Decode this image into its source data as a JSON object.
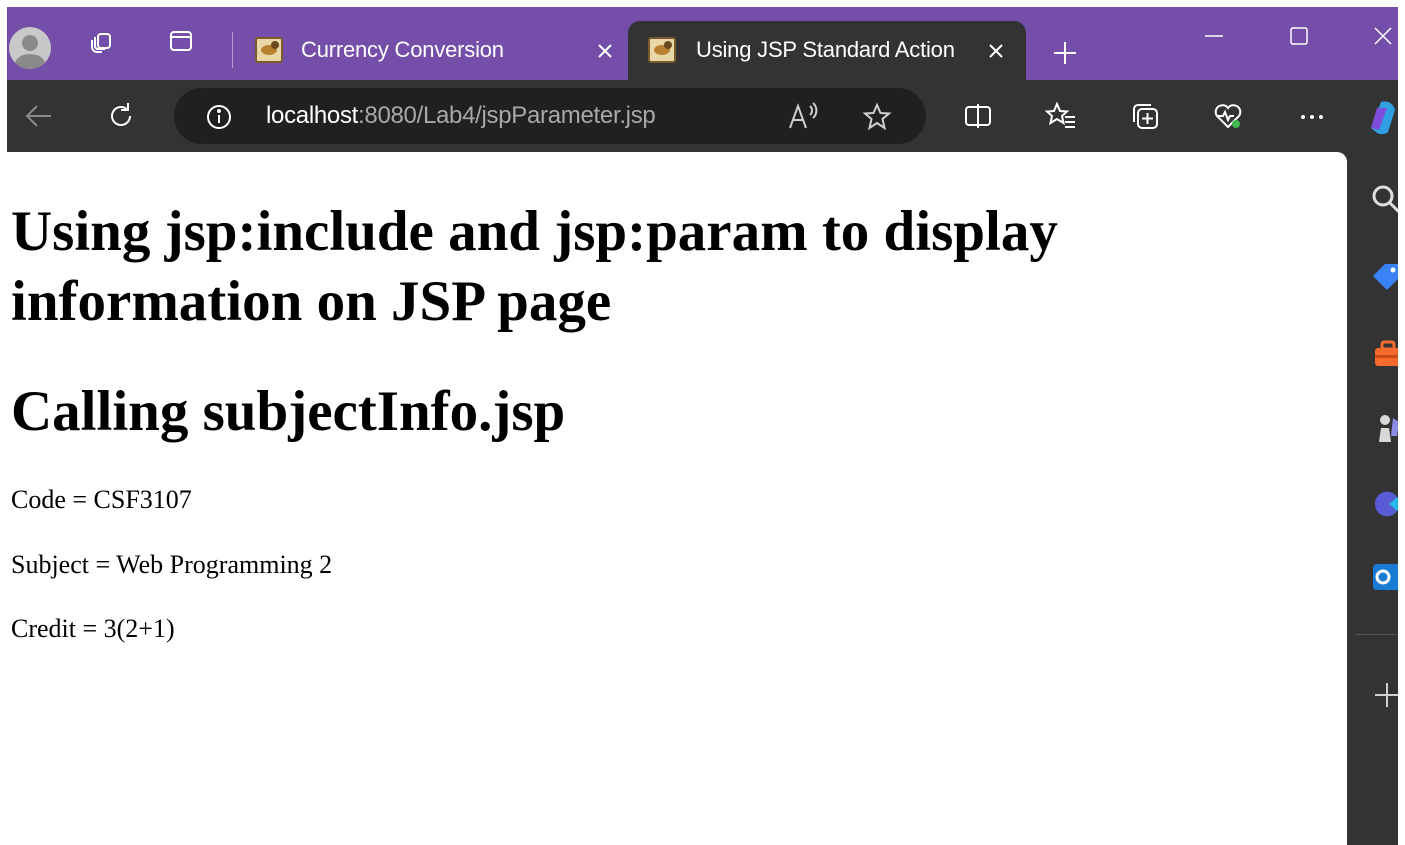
{
  "tabs": [
    {
      "title": "Currency Conversion",
      "active": false,
      "favicon": "tomcat-icon"
    },
    {
      "title": "Using JSP Standard Action",
      "active": true,
      "favicon": "tomcat-icon"
    }
  ],
  "address_bar": {
    "host": "localhost",
    "rest": ":8080/Lab4/jspParameter.jsp"
  },
  "page": {
    "heading": "Using jsp:include and jsp:param to display information on JSP page",
    "subheading": "Calling subjectInfo.jsp",
    "lines": [
      "Code = CSF3107",
      "Subject = Web Programming 2",
      "Credit = 3(2+1)"
    ]
  },
  "colors": {
    "tabstrip": "#744ea8",
    "toolbar": "#333333",
    "address_field": "#202020",
    "page_background": "#ffffff"
  },
  "icons": {
    "sidebar": [
      "search-icon",
      "tag-icon",
      "toolbox-icon",
      "chess-icon",
      "copilot-icon",
      "outlook-icon",
      "add-icon"
    ]
  }
}
